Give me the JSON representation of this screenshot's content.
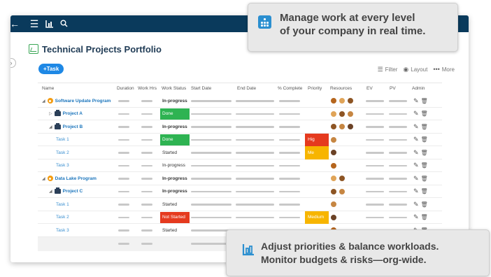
{
  "app": {
    "title": "Technical Projects Portfolio",
    "add_task_label": "+Task",
    "toolbar": {
      "filter_label": "Filter",
      "layout_label": "Layout",
      "more_label": "More"
    }
  },
  "table": {
    "headers": [
      "Name",
      "Duration",
      "Work Hrs",
      "Work Status",
      "Start Date",
      "End Date",
      "% Complete",
      "Priority",
      "Resources",
      "EV",
      "PV",
      "Admin"
    ],
    "rows": [
      {
        "name": "Software Update Program",
        "kind": "program",
        "status": "In-progress",
        "status_style": "text-bold",
        "priority": "",
        "avatars": 3
      },
      {
        "name": "Project A",
        "kind": "project",
        "status": "Done",
        "status_style": "done",
        "priority": "",
        "avatars": 3
      },
      {
        "name": "Project B",
        "kind": "project",
        "status": "In-progress",
        "status_style": "text-bold",
        "priority": "",
        "avatars": 3
      },
      {
        "name": "Task 1",
        "kind": "task",
        "status": "Done",
        "status_style": "done",
        "priority": "Hig",
        "priority_style": "high",
        "avatars": 1
      },
      {
        "name": "Task 2",
        "kind": "task",
        "status": "Started",
        "status_style": "text",
        "priority": "Me",
        "priority_style": "med",
        "avatars": 1
      },
      {
        "name": "Task 3",
        "kind": "task",
        "status": "In-progress",
        "status_style": "text",
        "priority": "",
        "avatars": 1
      },
      {
        "name": "Data Lake Program",
        "kind": "program",
        "status": "In-progress",
        "status_style": "text-bold",
        "priority": "",
        "avatars": 2
      },
      {
        "name": "Project C",
        "kind": "project",
        "status": "In-progress",
        "status_style": "text-bold",
        "priority": "",
        "avatars": 2
      },
      {
        "name": "Task 1",
        "kind": "task",
        "status": "Started",
        "status_style": "text",
        "priority": "",
        "avatars": 1
      },
      {
        "name": "Task 2",
        "kind": "task",
        "status": "Not Started",
        "status_style": "notstarted",
        "priority": "Medium",
        "priority_style": "med",
        "avatars": 1
      },
      {
        "name": "Task 3",
        "kind": "task",
        "status": "Started",
        "status_style": "text",
        "priority": "",
        "avatars": 1
      }
    ]
  },
  "callouts": {
    "top_line1": "Manage work at every level",
    "top_line2": "of your company in real time.",
    "bottom_line1": "Adjust priorities & balance workloads.",
    "bottom_line2": "Monitor budgets & risks—org-wide."
  },
  "colors": {
    "topbar": "#0a3a5c",
    "accent_blue": "#1e88e5",
    "done_green": "#2eb352",
    "not_started_red": "#e53a1e",
    "medium_yellow": "#f7b500"
  },
  "icons": [
    "back-arrow-icon",
    "menu-icon",
    "chart-icon",
    "search-icon",
    "filter-icon",
    "layout-eye-icon",
    "more-dots-icon",
    "edit-icon",
    "trash-icon"
  ]
}
